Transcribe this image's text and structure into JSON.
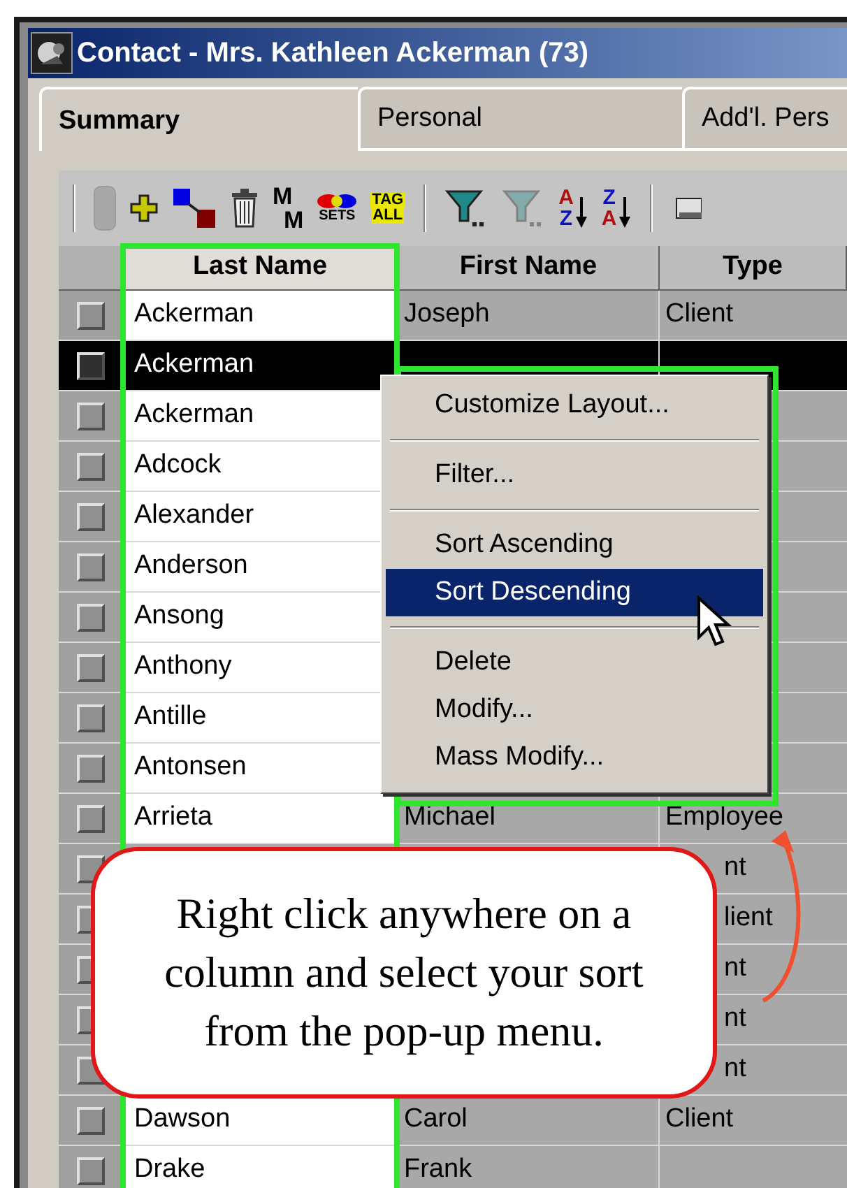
{
  "window": {
    "title": "Contact - Mrs. Kathleen Ackerman (73)"
  },
  "tabs": [
    {
      "label": "Summary",
      "selected": true
    },
    {
      "label": "Personal",
      "selected": false
    },
    {
      "label": "Add'l. Pers",
      "selected": false
    }
  ],
  "toolbar": [
    {
      "kind": "separator"
    },
    {
      "kind": "record",
      "disabled": true
    },
    {
      "kind": "add",
      "disabled": false
    },
    {
      "kind": "link",
      "disabled": false
    },
    {
      "kind": "delete",
      "disabled": false
    },
    {
      "kind": "text",
      "lines": [
        "M",
        "M"
      ],
      "disabled": false
    },
    {
      "kind": "sets",
      "lines": [
        "SETS"
      ],
      "disabled": false
    },
    {
      "kind": "tag",
      "lines": [
        "TAG",
        "ALL"
      ],
      "disabled": false
    },
    {
      "kind": "separator"
    },
    {
      "kind": "filter",
      "disabled": false
    },
    {
      "kind": "filter",
      "disabled": true
    },
    {
      "kind": "sort",
      "lines": [
        "A",
        "Z"
      ],
      "disabled": false
    },
    {
      "kind": "sort",
      "lines": [
        "Z",
        "A"
      ],
      "disabled": false
    },
    {
      "kind": "separator"
    },
    {
      "kind": "print",
      "disabled": false
    }
  ],
  "grid": {
    "columns": [
      "Last Name",
      "First Name",
      "Type"
    ],
    "rows": [
      {
        "last": "Ackerman",
        "first": "Joseph",
        "type": "Client",
        "selected": false
      },
      {
        "last": "Ackerman",
        "selected": true
      },
      {
        "last": "Ackerman",
        "selected": false
      },
      {
        "last": "Adcock",
        "selected": false
      },
      {
        "last": "Alexander",
        "selected": false
      },
      {
        "last": "Anderson",
        "selected": false
      },
      {
        "last": "Ansong",
        "selected": false
      },
      {
        "last": "Anthony",
        "selected": false
      },
      {
        "last": "Antille",
        "selected": false
      },
      {
        "last": "Antonsen",
        "selected": false
      },
      {
        "last": "Arrieta",
        "first": "Michael",
        "type": "Employee",
        "selected": false
      },
      {
        "type": "nt",
        "covered": true,
        "selected": false
      },
      {
        "type": "lient",
        "covered": true,
        "selected": false
      },
      {
        "type": "nt",
        "covered": true,
        "selected": false
      },
      {
        "type": "nt",
        "covered": true,
        "selected": false
      },
      {
        "type": "nt",
        "covered": true,
        "selected": false
      },
      {
        "last": "Dawson",
        "first": "Carol",
        "type": "Client",
        "selected": false
      },
      {
        "last": "Drake",
        "first": "Frank",
        "selected": false
      }
    ]
  },
  "context_menu": {
    "items": [
      {
        "kind": "item",
        "label": "Customize Layout...",
        "selected": false
      },
      {
        "kind": "separator"
      },
      {
        "kind": "item",
        "label": "Filter...",
        "selected": false
      },
      {
        "kind": "separator"
      },
      {
        "kind": "item",
        "label": "Sort Ascending",
        "selected": false
      },
      {
        "kind": "item",
        "label": "Sort Descending",
        "selected": true
      },
      {
        "kind": "separator"
      },
      {
        "kind": "item",
        "label": "Delete",
        "selected": false
      },
      {
        "kind": "item",
        "label": "Modify...",
        "selected": false
      },
      {
        "kind": "item",
        "label": "Mass Modify...",
        "selected": false
      }
    ]
  },
  "callout": {
    "text": "Right click anywhere on a column and select your sort from the pop-up menu."
  }
}
